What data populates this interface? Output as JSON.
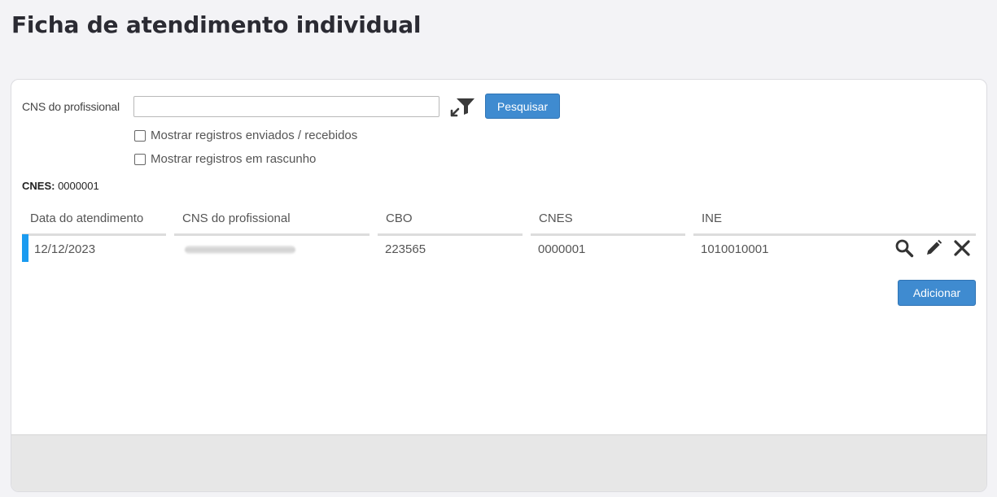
{
  "page": {
    "title": "Ficha de atendimento individual"
  },
  "filter": {
    "cns_label": "CNS do profissional",
    "cns_value": "",
    "search_label": "Pesquisar",
    "checkbox_sent": "Mostrar registros enviados / recebidos",
    "checkbox_draft": "Mostrar registros em rascunho",
    "cnes_label": "CNES:",
    "cnes_value": "0000001"
  },
  "table": {
    "headers": [
      "Data do atendimento",
      "CNS do profissional",
      "CBO",
      "CNES",
      "INE"
    ],
    "rows": [
      {
        "date": "12/12/2023",
        "cns": "",
        "cbo": "223565",
        "cnes": "0000001",
        "ine": "1010010001"
      }
    ]
  },
  "actions": {
    "add_label": "Adicionar"
  },
  "icons": {
    "filter": "clear-filter-icon",
    "view": "magnifier-icon",
    "edit": "pencil-icon",
    "delete": "close-icon"
  },
  "colors": {
    "primary_button": "#3f8bd0",
    "row_marker": "#1a9bf0"
  }
}
